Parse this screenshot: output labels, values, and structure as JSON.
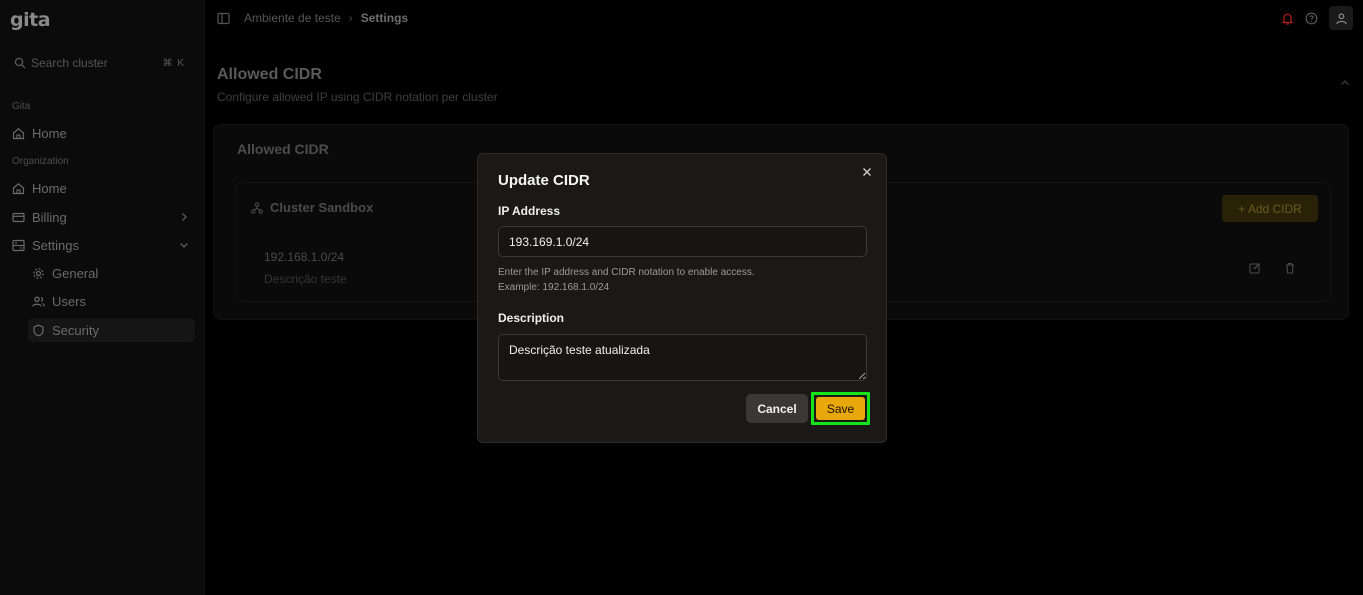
{
  "sidebar": {
    "logo": "gita",
    "search": {
      "placeholder": "Search cluster",
      "shortcut": "⌘ K"
    },
    "section_gita": "Gita",
    "home_label": "Home",
    "section_org": "Organization",
    "org_home_label": "Home",
    "billing_label": "Billing",
    "settings_label": "Settings",
    "general_label": "General",
    "users_label": "Users",
    "security_label": "Security"
  },
  "topbar": {
    "breadcrumb_env": "Ambiente de teste",
    "breadcrumb_sep": "›",
    "breadcrumb_current": "Settings"
  },
  "page": {
    "title": "Allowed CIDR",
    "subtitle": "Configure allowed IP using CIDR notation per cluster",
    "card_title": "Allowed CIDR",
    "cluster_name": "Cluster Sandbox",
    "add_cidr_label": "+ Add CIDR",
    "rows": [
      {
        "ip": "192.168.1.0/24",
        "description": "Descrição teste"
      }
    ]
  },
  "modal": {
    "title": "Update CIDR",
    "ip_label": "IP Address",
    "ip_value": "193.169.1.0/24",
    "help_line1": "Enter the IP address and CIDR notation to enable access.",
    "help_line2": "Example: 192.168.1.0/24",
    "description_label": "Description",
    "description_value": "Descrição teste atualizada",
    "cancel_label": "Cancel",
    "save_label": "Save"
  },
  "colors": {
    "accent": "#e8a70a",
    "highlight": "#16e619",
    "notification": "#b3201a"
  }
}
